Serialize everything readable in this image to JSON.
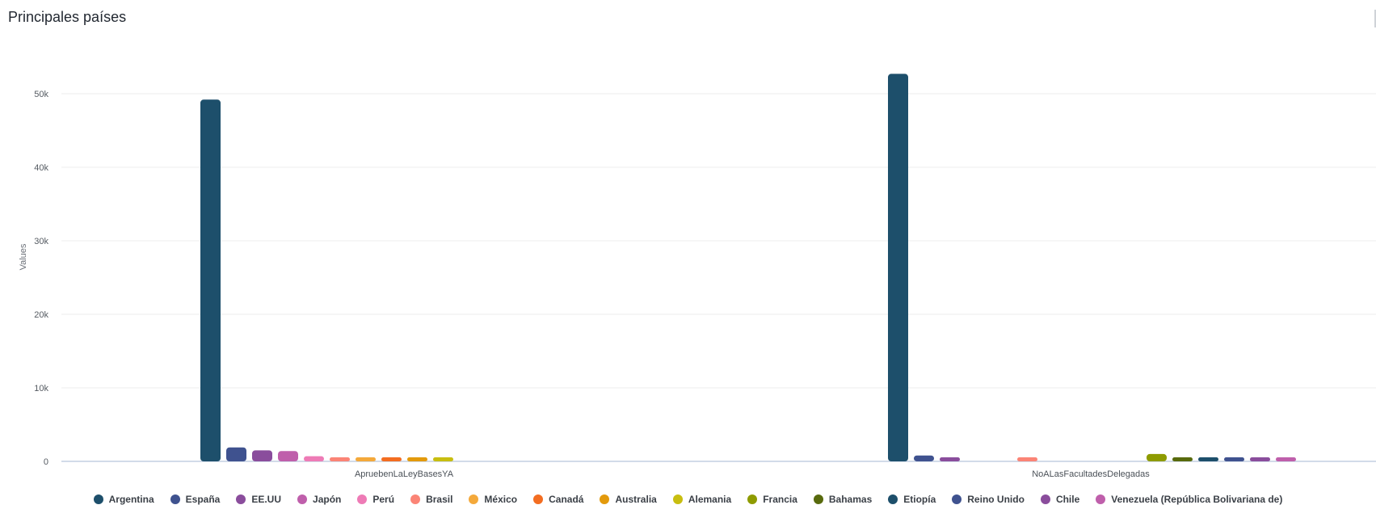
{
  "header": {
    "title": "Principales países"
  },
  "chart_data": {
    "type": "bar",
    "title": "Principales países",
    "xlabel": "",
    "ylabel": "Values",
    "ylim": [
      0,
      55000
    ],
    "yticks": [
      0,
      10000,
      20000,
      30000,
      40000,
      50000
    ],
    "ytick_labels": [
      "0",
      "10k",
      "20k",
      "30k",
      "40k",
      "50k"
    ],
    "grid": true,
    "legend_position": "bottom",
    "categories": [
      "ApruebenLaLeyBasesYA",
      "NoALasFacultadesDelegadas"
    ],
    "series": [
      {
        "name": "Argentina",
        "color": "#1d4f6b",
        "values": [
          49200,
          52700
        ]
      },
      {
        "name": "España",
        "color": "#3f528f",
        "values": [
          1900,
          800
        ]
      },
      {
        "name": "EE.UU",
        "color": "#8a4d9c",
        "values": [
          1500,
          350
        ]
      },
      {
        "name": "Japón",
        "color": "#bf5fab",
        "values": [
          1400,
          null
        ]
      },
      {
        "name": "Perú",
        "color": "#ee7bb6",
        "values": [
          700,
          null
        ]
      },
      {
        "name": "Brasil",
        "color": "#fb8476",
        "values": [
          350,
          350
        ]
      },
      {
        "name": "México",
        "color": "#f4a93b",
        "values": [
          350,
          null
        ]
      },
      {
        "name": "Canadá",
        "color": "#f36d21",
        "values": [
          350,
          null
        ]
      },
      {
        "name": "Australia",
        "color": "#e39a0c",
        "values": [
          300,
          null
        ]
      },
      {
        "name": "Alemania",
        "color": "#c8be10",
        "values": [
          300,
          null
        ]
      },
      {
        "name": "Francia",
        "color": "#8e9b00",
        "values": [
          null,
          1000
        ]
      },
      {
        "name": "Bahamas",
        "color": "#586a0d",
        "values": [
          null,
          350
        ]
      },
      {
        "name": "Etiopía",
        "color": "#1d4f6b",
        "values": [
          null,
          350
        ]
      },
      {
        "name": "Reino Unido",
        "color": "#3f528f",
        "values": [
          null,
          350
        ]
      },
      {
        "name": "Chile",
        "color": "#8a4d9c",
        "values": [
          null,
          300
        ]
      },
      {
        "name": "Venezuela (República Bolivariana de)",
        "color": "#bf5fab",
        "values": [
          null,
          300
        ]
      }
    ]
  }
}
